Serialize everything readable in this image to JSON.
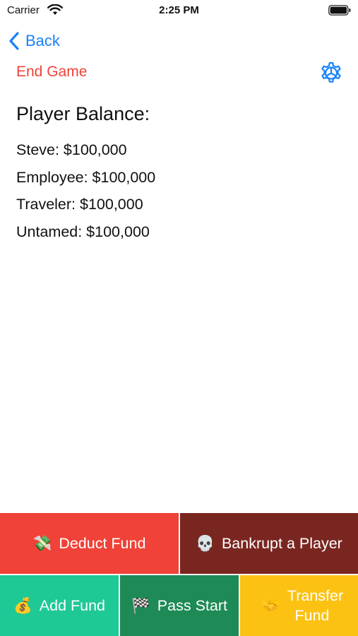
{
  "status_bar": {
    "carrier": "Carrier",
    "time": "2:25 PM"
  },
  "nav": {
    "back_label": "Back"
  },
  "end_game_label": "End Game",
  "section_title": "Player Balance:",
  "players": [
    {
      "text": "Steve: $100,000"
    },
    {
      "text": "Employee: $100,000"
    },
    {
      "text": "Traveler: $100,000"
    },
    {
      "text": "Untamed: $100,000"
    }
  ],
  "actions": {
    "deduct": {
      "emoji": "💸",
      "label": "Deduct Fund",
      "color": "#f04238"
    },
    "bankrupt": {
      "emoji": "💀",
      "label": "Bankrupt a Player",
      "color": "#7a2620"
    },
    "add": {
      "emoji": "💰",
      "label": "Add Fund",
      "color": "#1ec995"
    },
    "pass": {
      "emoji": "🏁",
      "label": "Pass Start",
      "color": "#1e8a56"
    },
    "transfer": {
      "emoji": "🤝",
      "label": "Transfer Fund",
      "color": "#fbc213"
    }
  },
  "colors": {
    "accent_blue": "#1a82f7",
    "end_game_red": "#f0423a"
  },
  "icons": {
    "settings": "gear-icon",
    "back": "chevron-left-icon"
  }
}
